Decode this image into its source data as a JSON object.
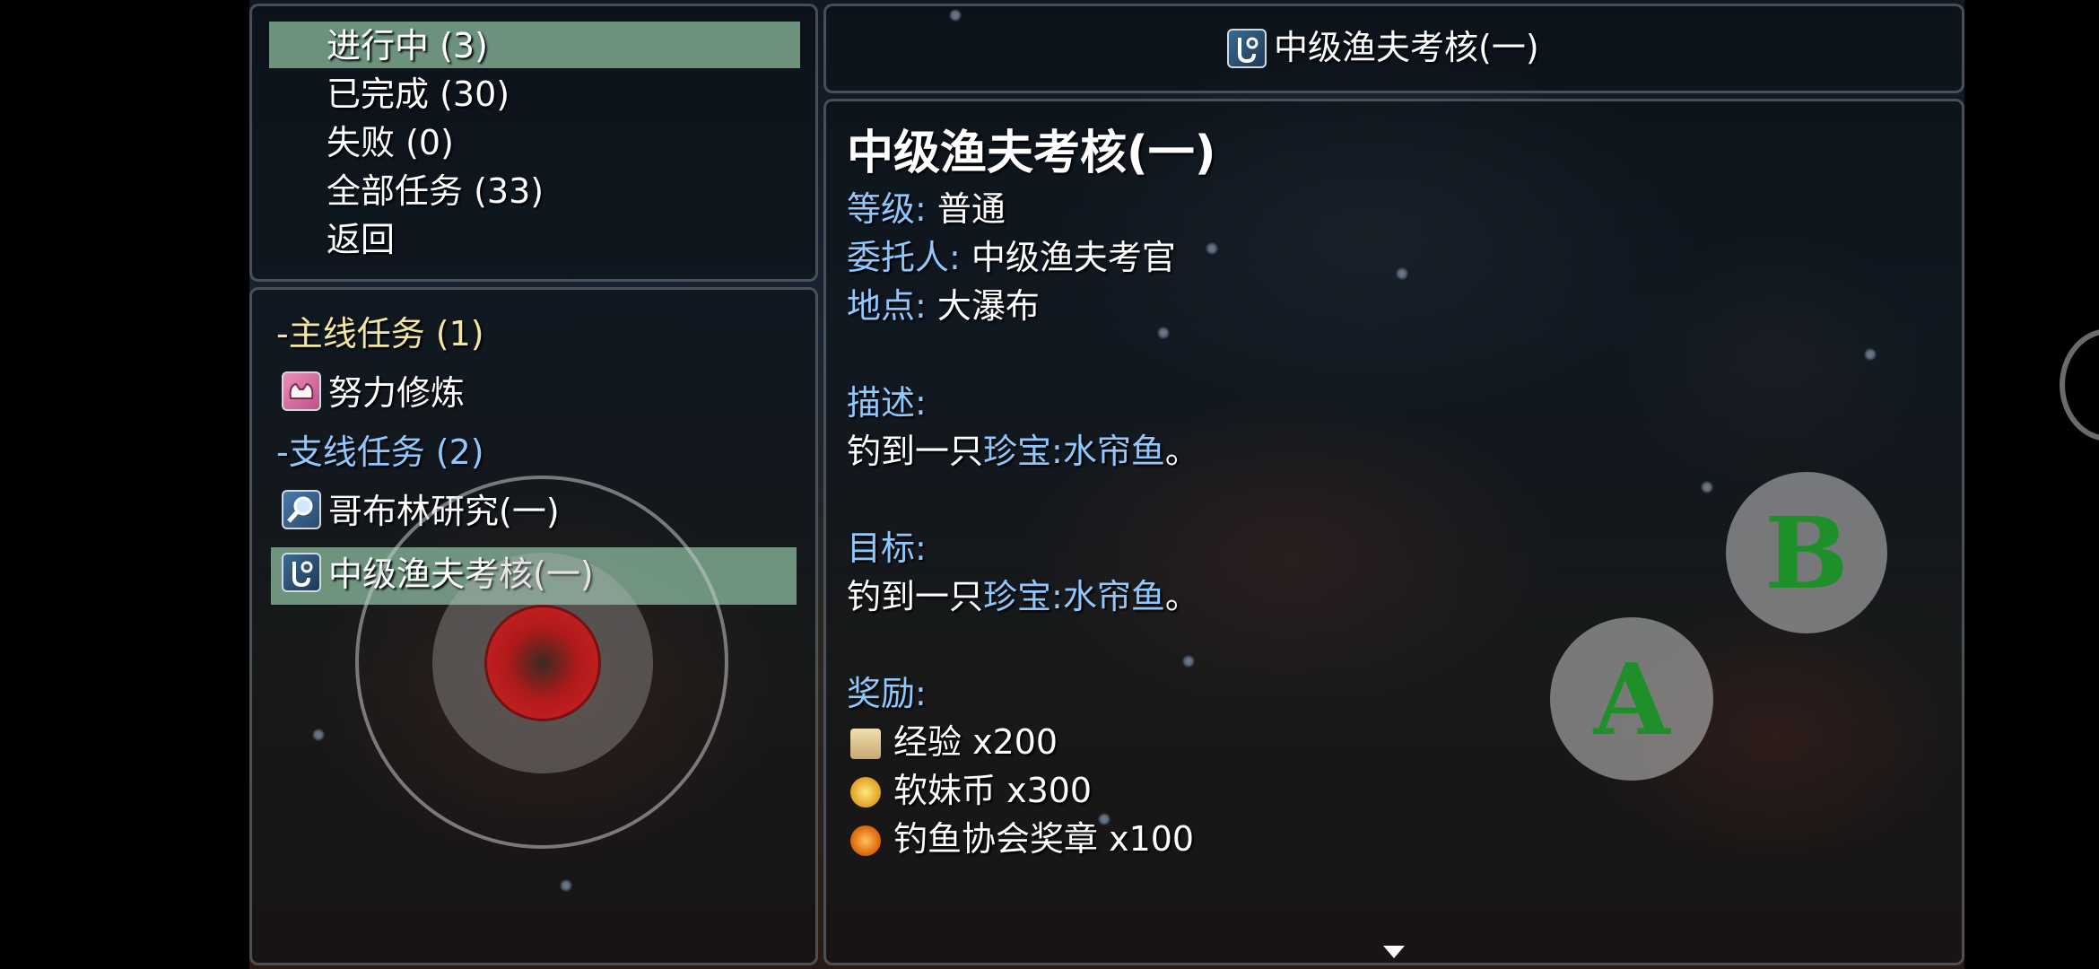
{
  "menu": {
    "items": [
      {
        "label": "进行中 (3)"
      },
      {
        "label": "已完成 (30)"
      },
      {
        "label": "失败 (0)"
      },
      {
        "label": "全部任务 (33)"
      },
      {
        "label": "返回"
      }
    ],
    "selected_index": 0
  },
  "quest_list": {
    "main_category": "-主线任务 (1)",
    "main_quests": [
      {
        "label": "努力修炼",
        "icon": "muscle-icon"
      }
    ],
    "side_category": "-支线任务 (2)",
    "side_quests": [
      {
        "label": "哥布林研究(一)",
        "icon": "magnifier-icon"
      },
      {
        "label": "中级渔夫考核(一)",
        "icon": "fishing-hook-icon"
      }
    ],
    "selected": "中级渔夫考核(一)"
  },
  "header": {
    "title": "中级渔夫考核(一)",
    "icon": "fishing-hook-icon"
  },
  "detail": {
    "title": "中级渔夫考核(一)",
    "level_label": "等级:",
    "level_value": "普通",
    "client_label": "委托人:",
    "client_value": "中级渔夫考官",
    "location_label": "地点:",
    "location_value": "大瀑布",
    "description_label": "描述:",
    "description_prefix": "钓到一只",
    "description_highlight": "珍宝:水帘鱼",
    "description_suffix": "。",
    "goal_label": "目标:",
    "goal_prefix": "钓到一只",
    "goal_highlight": "珍宝:水帘鱼",
    "goal_suffix": "。",
    "rewards_label": "奖励:",
    "rewards": [
      {
        "label": "经验 x200",
        "icon": "scroll-icon"
      },
      {
        "label": "软妹币 x300",
        "icon": "coins-icon"
      },
      {
        "label": "钓鱼协会奖章 x100",
        "icon": "medal-icon"
      }
    ]
  },
  "controls": {
    "a_label": "A",
    "b_label": "B"
  },
  "colors": {
    "highlight_row": "#8cbea0",
    "label_blue": "#8fc8ff",
    "category_yellow": "#f3e6a0",
    "button_letter_green": "#1f8f2a"
  }
}
